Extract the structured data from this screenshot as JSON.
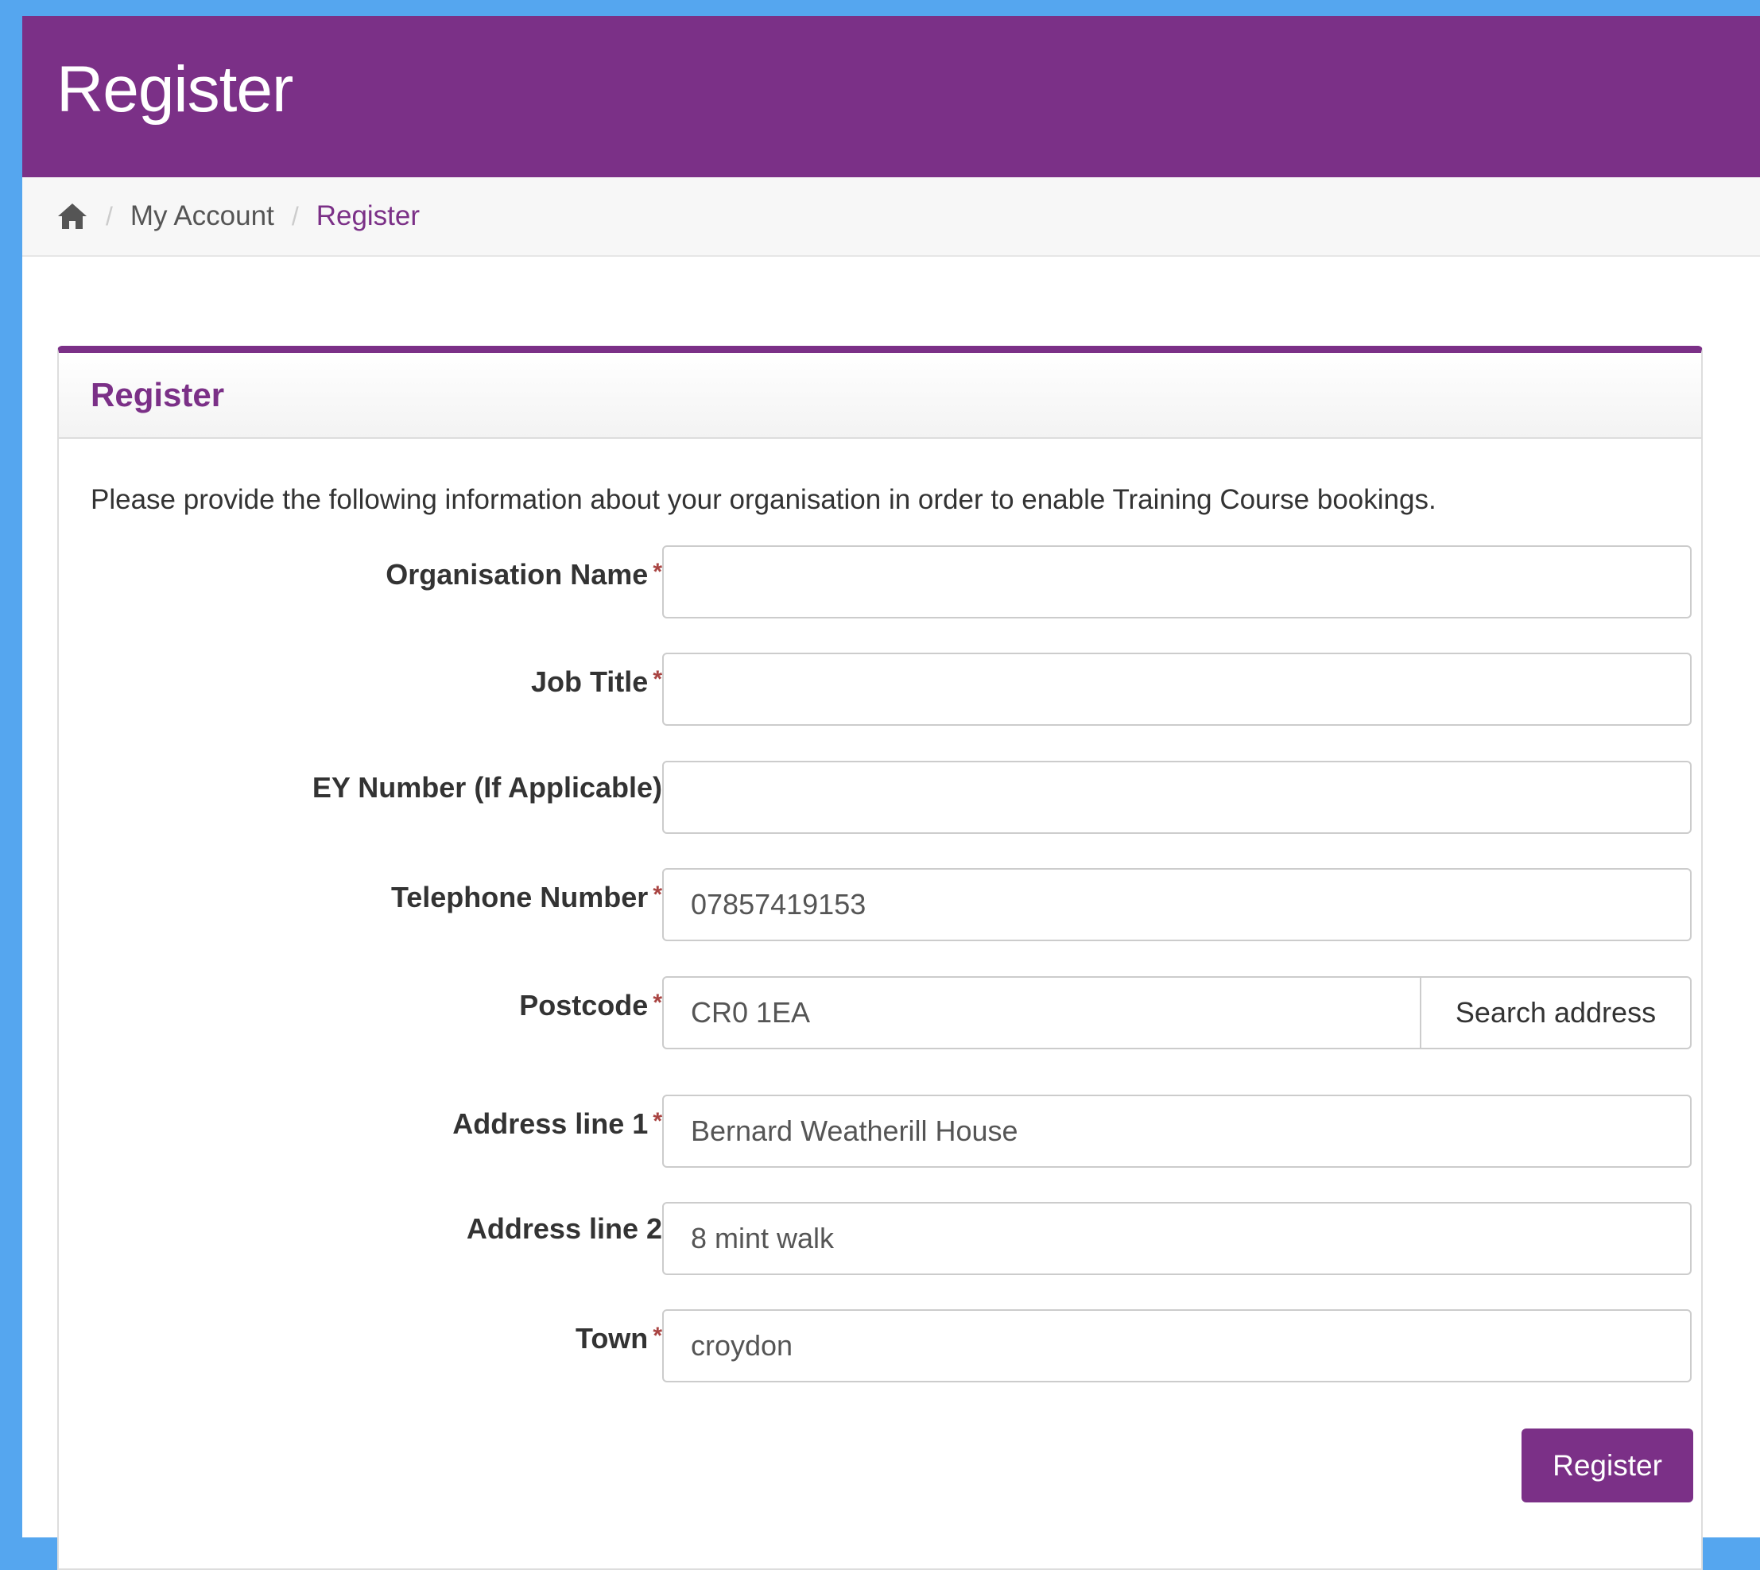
{
  "header": {
    "title": "Register"
  },
  "breadcrumb": {
    "items": [
      {
        "label": "My Account"
      },
      {
        "label": "Register"
      }
    ]
  },
  "panel": {
    "title": "Register",
    "intro": "Please provide the following information about your organisation in order to enable Training Course bookings."
  },
  "form": {
    "required_mark": "*",
    "organisation_name": {
      "label": "Organisation Name",
      "value": ""
    },
    "job_title": {
      "label": "Job Title",
      "value": ""
    },
    "ey_number": {
      "label": "EY Number (If Applicable)",
      "value": ""
    },
    "telephone": {
      "label": "Telephone Number",
      "value": "07857419153"
    },
    "postcode": {
      "label": "Postcode",
      "value": "CR0 1EA",
      "search_label": "Search address"
    },
    "address_line_1": {
      "label": "Address line 1",
      "value": "Bernard Weatherill House"
    },
    "address_line_2": {
      "label": "Address line 2",
      "value": "8 mint walk"
    },
    "town": {
      "label": "Town",
      "value": "croydon"
    },
    "submit_label": "Register"
  },
  "colors": {
    "brand": "#7b3087",
    "required": "#a94442"
  }
}
